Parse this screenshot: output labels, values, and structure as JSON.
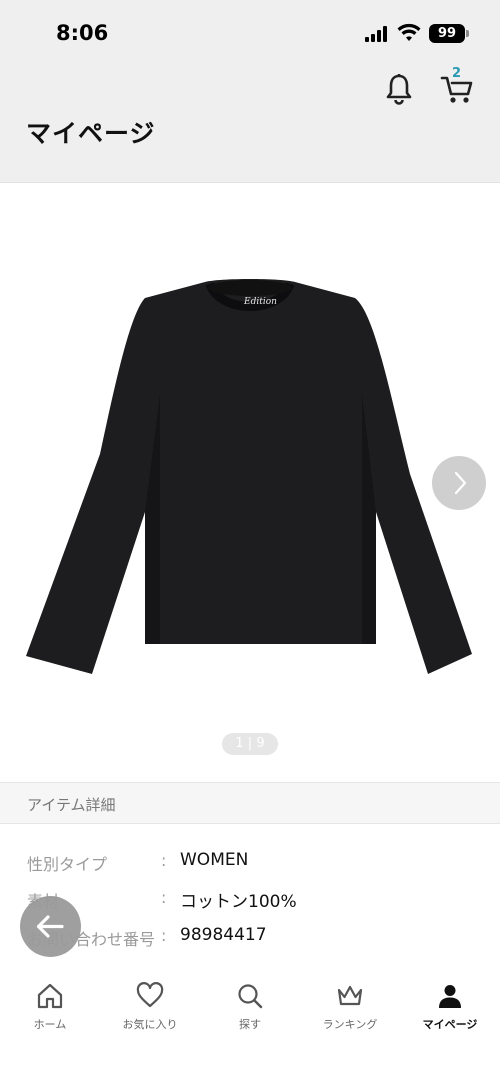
{
  "status_bar": {
    "time": "8:06",
    "battery": "99"
  },
  "header": {
    "title": "マイページ",
    "cart_count": "2"
  },
  "gallery": {
    "pager": "1 | 9",
    "image_alt": "黒のロングスリーブトップス"
  },
  "details": {
    "section_title": "アイテム詳細",
    "rows": [
      {
        "label": "性別タイプ",
        "sep": ":",
        "value": "WOMEN"
      },
      {
        "label": "素材",
        "sep": ":",
        "value": "コットン100%"
      },
      {
        "label": "お問い合わせ番号",
        "sep": ":",
        "value": "98984417"
      }
    ]
  },
  "bottom_nav": [
    {
      "label": "ホーム",
      "icon": "home-icon"
    },
    {
      "label": "お気に入り",
      "icon": "heart-icon"
    },
    {
      "label": "探す",
      "icon": "search-icon"
    },
    {
      "label": "ランキング",
      "icon": "crown-icon"
    },
    {
      "label": "マイページ",
      "icon": "user-icon"
    }
  ],
  "colors": {
    "header_bg": "#efefef",
    "cart_badge": "#2a9ab3",
    "active_nav": "#111111"
  }
}
